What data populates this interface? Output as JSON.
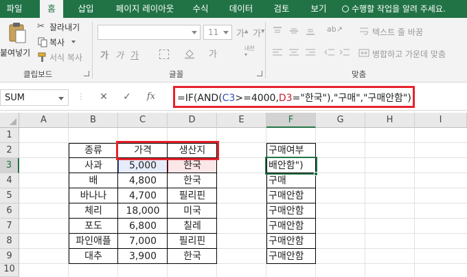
{
  "tabs": [
    "파일",
    "홈",
    "삽입",
    "페이지 레이아웃",
    "수식",
    "데이터",
    "검토",
    "보기"
  ],
  "active_tab": "홈",
  "tell_me": "수행할 작업을 알려 주세요.",
  "clipboard": {
    "paste_label": "붙여넣기",
    "cut_label": "잘라내기",
    "copy_label": "복사",
    "format_painter_label": "서식 복사",
    "group_label": "클립보드"
  },
  "font": {
    "size_value": "11",
    "group_label": "글꼴"
  },
  "alignment": {
    "wrap_text_label": "텍스트 줄 바꿈",
    "merge_label": "병합하고 가운데 맞춤",
    "group_label": "맞춤"
  },
  "name_box": "SUM",
  "formula_bar": {
    "part1": "=IF(AND(",
    "ref1": "C3",
    "part2": ">=4000,",
    "ref2": "D3",
    "part3": "=\"한국\"),\"구매\",\"구매안함\")"
  },
  "columns": [
    "A",
    "B",
    "C",
    "D",
    "E",
    "F",
    "G",
    "H",
    "I"
  ],
  "rows": [
    "1",
    "2",
    "3",
    "4",
    "5",
    "6",
    "7",
    "8",
    "9",
    "10"
  ],
  "table": {
    "headers": [
      "종류",
      "가격",
      "생산지"
    ],
    "rows": [
      [
        "사과",
        "5,000",
        "한국"
      ],
      [
        "배",
        "4,800",
        "한국"
      ],
      [
        "바나나",
        "4,700",
        "필리핀"
      ],
      [
        "체리",
        "18,000",
        "미국"
      ],
      [
        "포도",
        "6,800",
        "칠레"
      ],
      [
        "파인애플",
        "7,000",
        "필리핀"
      ],
      [
        "대추",
        "3,900",
        "한국"
      ]
    ]
  },
  "purchase": {
    "header": "구매여부",
    "values": [
      "배안함\")",
      "구매",
      "구매안함",
      "구매안함",
      "구매안함",
      "구매안함",
      "구매안함"
    ]
  },
  "colors": {
    "excel_green": "#217346",
    "highlight_red": "#e8212b",
    "ref_blue": "#3050c0",
    "ref_red": "#c02030"
  }
}
